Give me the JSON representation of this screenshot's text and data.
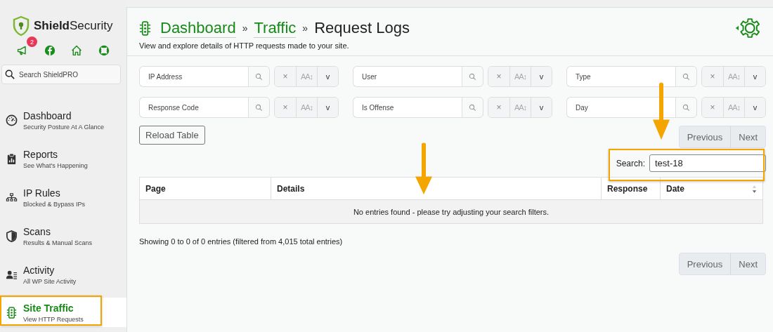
{
  "sidebar": {
    "logo": "**Shield**Security",
    "notification_count": "2",
    "search": {
      "placeholder": "Search ShieldPRO"
    },
    "items": [
      {
        "title": "Dashboard",
        "subtitle": "Security Posture At A Glance",
        "selected": false
      },
      {
        "title": "Reports",
        "subtitle": "See What's Happening",
        "selected": false
      },
      {
        "title": "IP Rules",
        "subtitle": "Blocked & Bypass IPs",
        "selected": false
      },
      {
        "title": "Scans",
        "subtitle": "Results & Manual Scans",
        "selected": false
      },
      {
        "title": "Activity",
        "subtitle": "All WP Site Activity",
        "selected": false
      },
      {
        "title": "Site Traffic",
        "subtitle": "View HTTP Requests",
        "selected": true
      }
    ]
  },
  "header": {
    "breadcrumbs": [
      {
        "label": "Dashboard",
        "kind": "link"
      },
      {
        "separator": "»",
        "label": "Traffic",
        "kind": "link"
      },
      {
        "separator": "»",
        "label": "Request Logs",
        "kind": "current"
      }
    ],
    "description": "View and explore details of HTTP requests made to your site."
  },
  "filters": [
    {
      "placeholder": "IP Address",
      "clear": "×",
      "case": "AA↕",
      "toggle": "v"
    },
    {
      "placeholder": "User",
      "clear": "×",
      "case": "AA↕",
      "toggle": "v"
    },
    {
      "placeholder": "Type",
      "clear": "×",
      "case": "AA↕",
      "toggle": "v"
    },
    {
      "placeholder": "Response Code",
      "clear": "×",
      "case": "AA↕",
      "toggle": "v"
    },
    {
      "placeholder": "Is Offense",
      "clear": "×",
      "case": "AA↕",
      "toggle": "v"
    },
    {
      "placeholder": "Day",
      "clear": "×",
      "case": "AA↕",
      "toggle": "v"
    }
  ],
  "reload_button": "Reload Table",
  "pagination_top": {
    "previous": "Previous",
    "next": "Next"
  },
  "search": {
    "label": "Search:",
    "value": "test-18"
  },
  "table": {
    "columns": [
      {
        "label": "Page",
        "sortable": false
      },
      {
        "label": "Details",
        "sortable": false
      },
      {
        "label": "Response",
        "sortable": false
      },
      {
        "label": "Date",
        "sortable": true
      }
    ],
    "empty_message": "No entries found - please try adjusting your search filters."
  },
  "info": "Showing 0 to 0 of 0 entries (filtered from 4,015 total entries)",
  "pagination_bottom": {
    "previous": "Previous",
    "next": "Next"
  },
  "annotations": [
    {
      "kind": "arrow"
    },
    {
      "kind": "arrow"
    },
    {
      "kind": "highlight"
    },
    {
      "kind": "highlight"
    }
  ]
}
